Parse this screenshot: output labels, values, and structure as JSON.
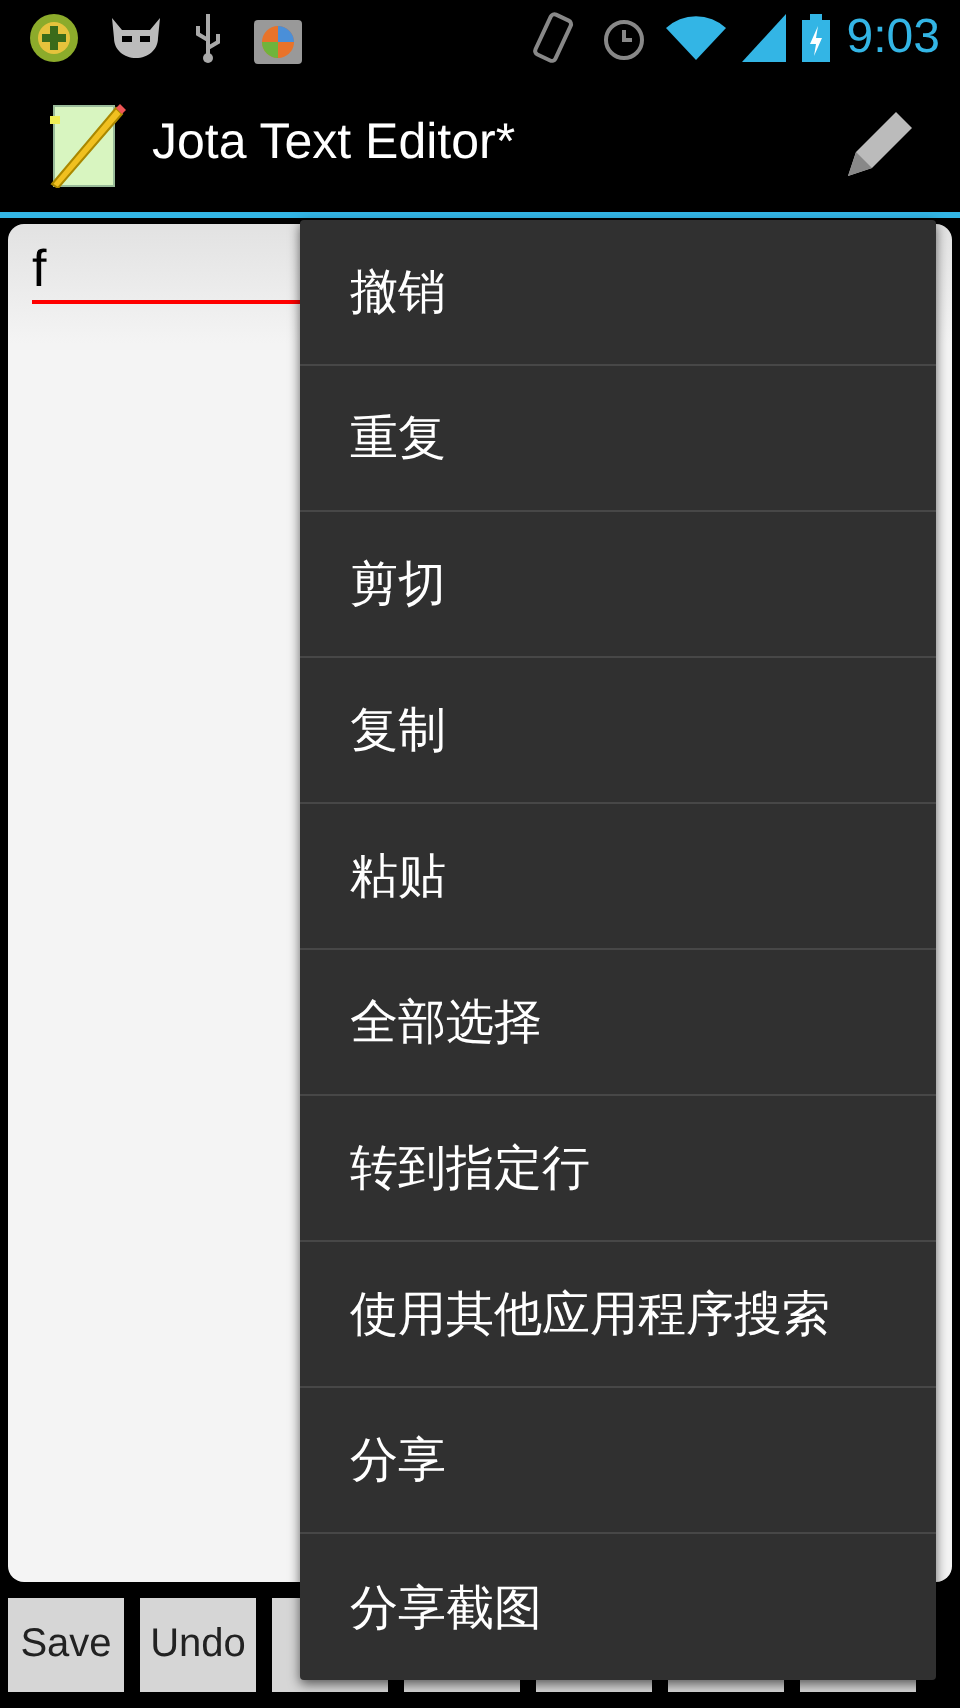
{
  "status_bar": {
    "time": "9:03"
  },
  "action_bar": {
    "title": "Jota Text Editor*"
  },
  "editor": {
    "text": "f"
  },
  "buttons": [
    {
      "kind": "labeled",
      "label": "Save"
    },
    {
      "kind": "labeled",
      "label": "Undo"
    },
    {
      "kind": "covered"
    },
    {
      "kind": "covered"
    },
    {
      "kind": "covered"
    },
    {
      "kind": "covered"
    },
    {
      "kind": "covered"
    }
  ],
  "menu": {
    "items": [
      {
        "label": "撤销"
      },
      {
        "label": "重复"
      },
      {
        "label": "剪切"
      },
      {
        "label": "复制"
      },
      {
        "label": "粘贴"
      },
      {
        "label": "全部选择"
      },
      {
        "label": "转到指定行"
      },
      {
        "label": "使用其他应用程序搜索"
      },
      {
        "label": "分享"
      },
      {
        "label": "分享截图"
      }
    ]
  }
}
